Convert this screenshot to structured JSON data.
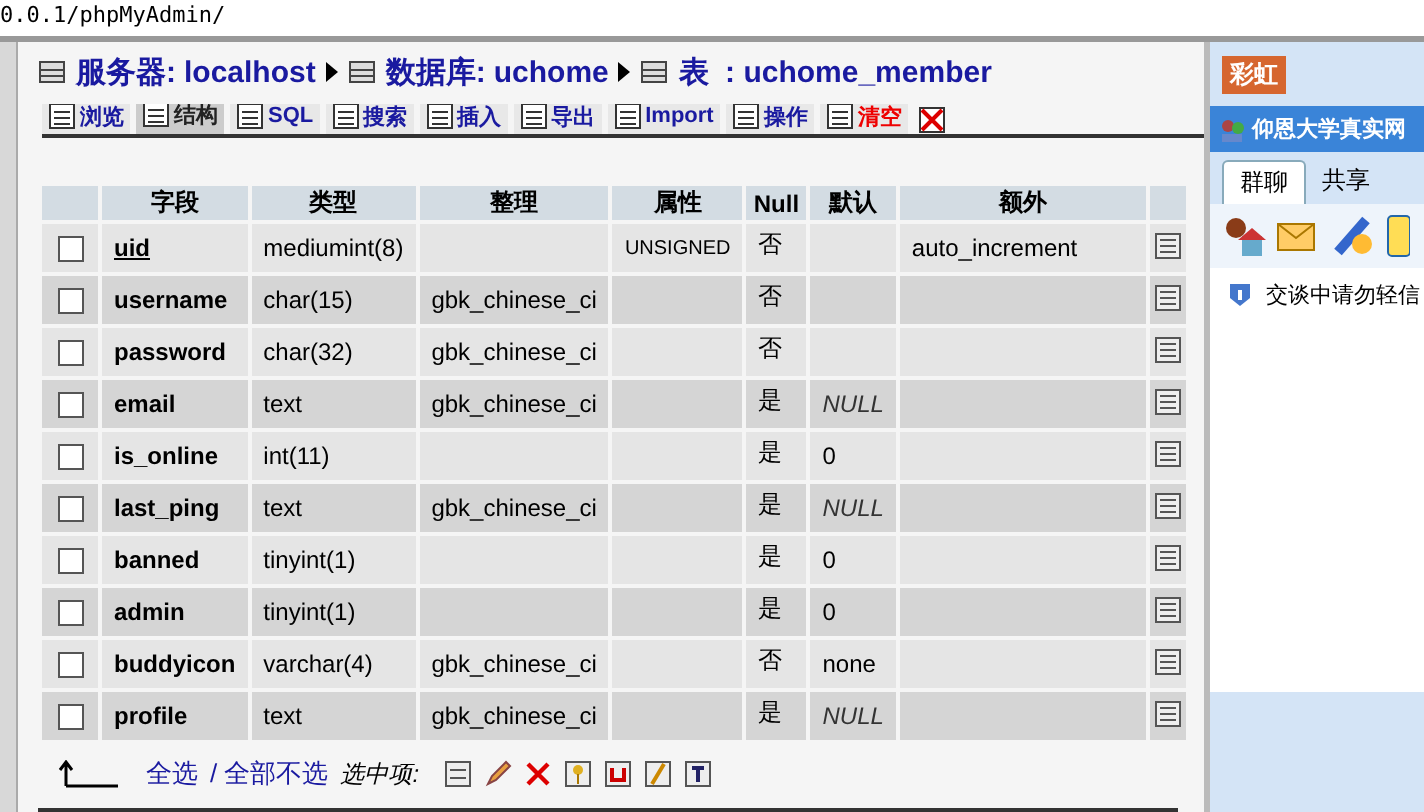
{
  "address_bar": {
    "url": "0.0.1/phpMyAdmin/"
  },
  "breadcrumb": [
    {
      "label": "服务器:",
      "value": "localhost"
    },
    {
      "label": "数据库:",
      "value": "uchome"
    },
    {
      "label": "表",
      "value": " : uchome_member"
    }
  ],
  "tabs": [
    {
      "label": "浏览",
      "selected": false,
      "danger": false
    },
    {
      "label": "结构",
      "selected": true,
      "danger": false
    },
    {
      "label": "SQL",
      "selected": false,
      "danger": false
    },
    {
      "label": "搜索",
      "selected": false,
      "danger": false
    },
    {
      "label": "插入",
      "selected": false,
      "danger": false
    },
    {
      "label": "导出",
      "selected": false,
      "danger": false
    },
    {
      "label": "Import",
      "selected": false,
      "danger": false
    },
    {
      "label": "操作",
      "selected": false,
      "danger": false
    },
    {
      "label": "清空",
      "selected": false,
      "danger": true
    }
  ],
  "table": {
    "columns": [
      "字段",
      "类型",
      "整理",
      "属性",
      "Null",
      "默认",
      "额外"
    ],
    "rows": [
      {
        "checked": false,
        "primary": true,
        "field": "uid",
        "type": "mediumint(8)",
        "collation": "",
        "attributes": "UNSIGNED",
        "null": "否",
        "default": "",
        "extra": "auto_increment"
      },
      {
        "checked": false,
        "primary": false,
        "field": "username",
        "type": "char(15)",
        "collation": "gbk_chinese_ci",
        "attributes": "",
        "null": "否",
        "default": "",
        "extra": ""
      },
      {
        "checked": false,
        "primary": false,
        "field": "password",
        "type": "char(32)",
        "collation": "gbk_chinese_ci",
        "attributes": "",
        "null": "否",
        "default": "",
        "extra": ""
      },
      {
        "checked": false,
        "primary": false,
        "field": "email",
        "type": "text",
        "collation": "gbk_chinese_ci",
        "attributes": "",
        "null": "是",
        "default": "NULL",
        "default_null": true,
        "extra": ""
      },
      {
        "checked": false,
        "primary": false,
        "field": "is_online",
        "type": "int(11)",
        "collation": "",
        "attributes": "",
        "null": "是",
        "default": "0",
        "default_null": false,
        "extra": ""
      },
      {
        "checked": false,
        "primary": false,
        "field": "last_ping",
        "type": "text",
        "collation": "gbk_chinese_ci",
        "attributes": "",
        "null": "是",
        "default": "NULL",
        "default_null": true,
        "extra": ""
      },
      {
        "checked": false,
        "primary": false,
        "field": "banned",
        "type": "tinyint(1)",
        "collation": "",
        "attributes": "",
        "null": "是",
        "default": "0",
        "default_null": false,
        "extra": ""
      },
      {
        "checked": false,
        "primary": false,
        "field": "admin",
        "type": "tinyint(1)",
        "collation": "",
        "attributes": "",
        "null": "是",
        "default": "0",
        "default_null": false,
        "extra": ""
      },
      {
        "checked": false,
        "primary": false,
        "field": "buddyicon",
        "type": "varchar(4)",
        "collation": "gbk_chinese_ci",
        "attributes": "",
        "null": "否",
        "default": "none",
        "default_null": false,
        "extra": ""
      },
      {
        "checked": false,
        "primary": false,
        "field": "profile",
        "type": "text",
        "collation": "gbk_chinese_ci",
        "attributes": "",
        "null": "是",
        "default": "NULL",
        "default_null": true,
        "extra": ""
      }
    ]
  },
  "footer": {
    "check_all": "全选",
    "uncheck_all": "/ 全部不选",
    "with_selected": "选中项:"
  },
  "chat_panel": {
    "app_tab": "彩虹",
    "window_title": "仰恩大学真实网",
    "tabs": [
      {
        "label": "群聊",
        "selected": true
      },
      {
        "label": "共享",
        "selected": false
      }
    ],
    "notice": "交谈中请勿轻信"
  }
}
